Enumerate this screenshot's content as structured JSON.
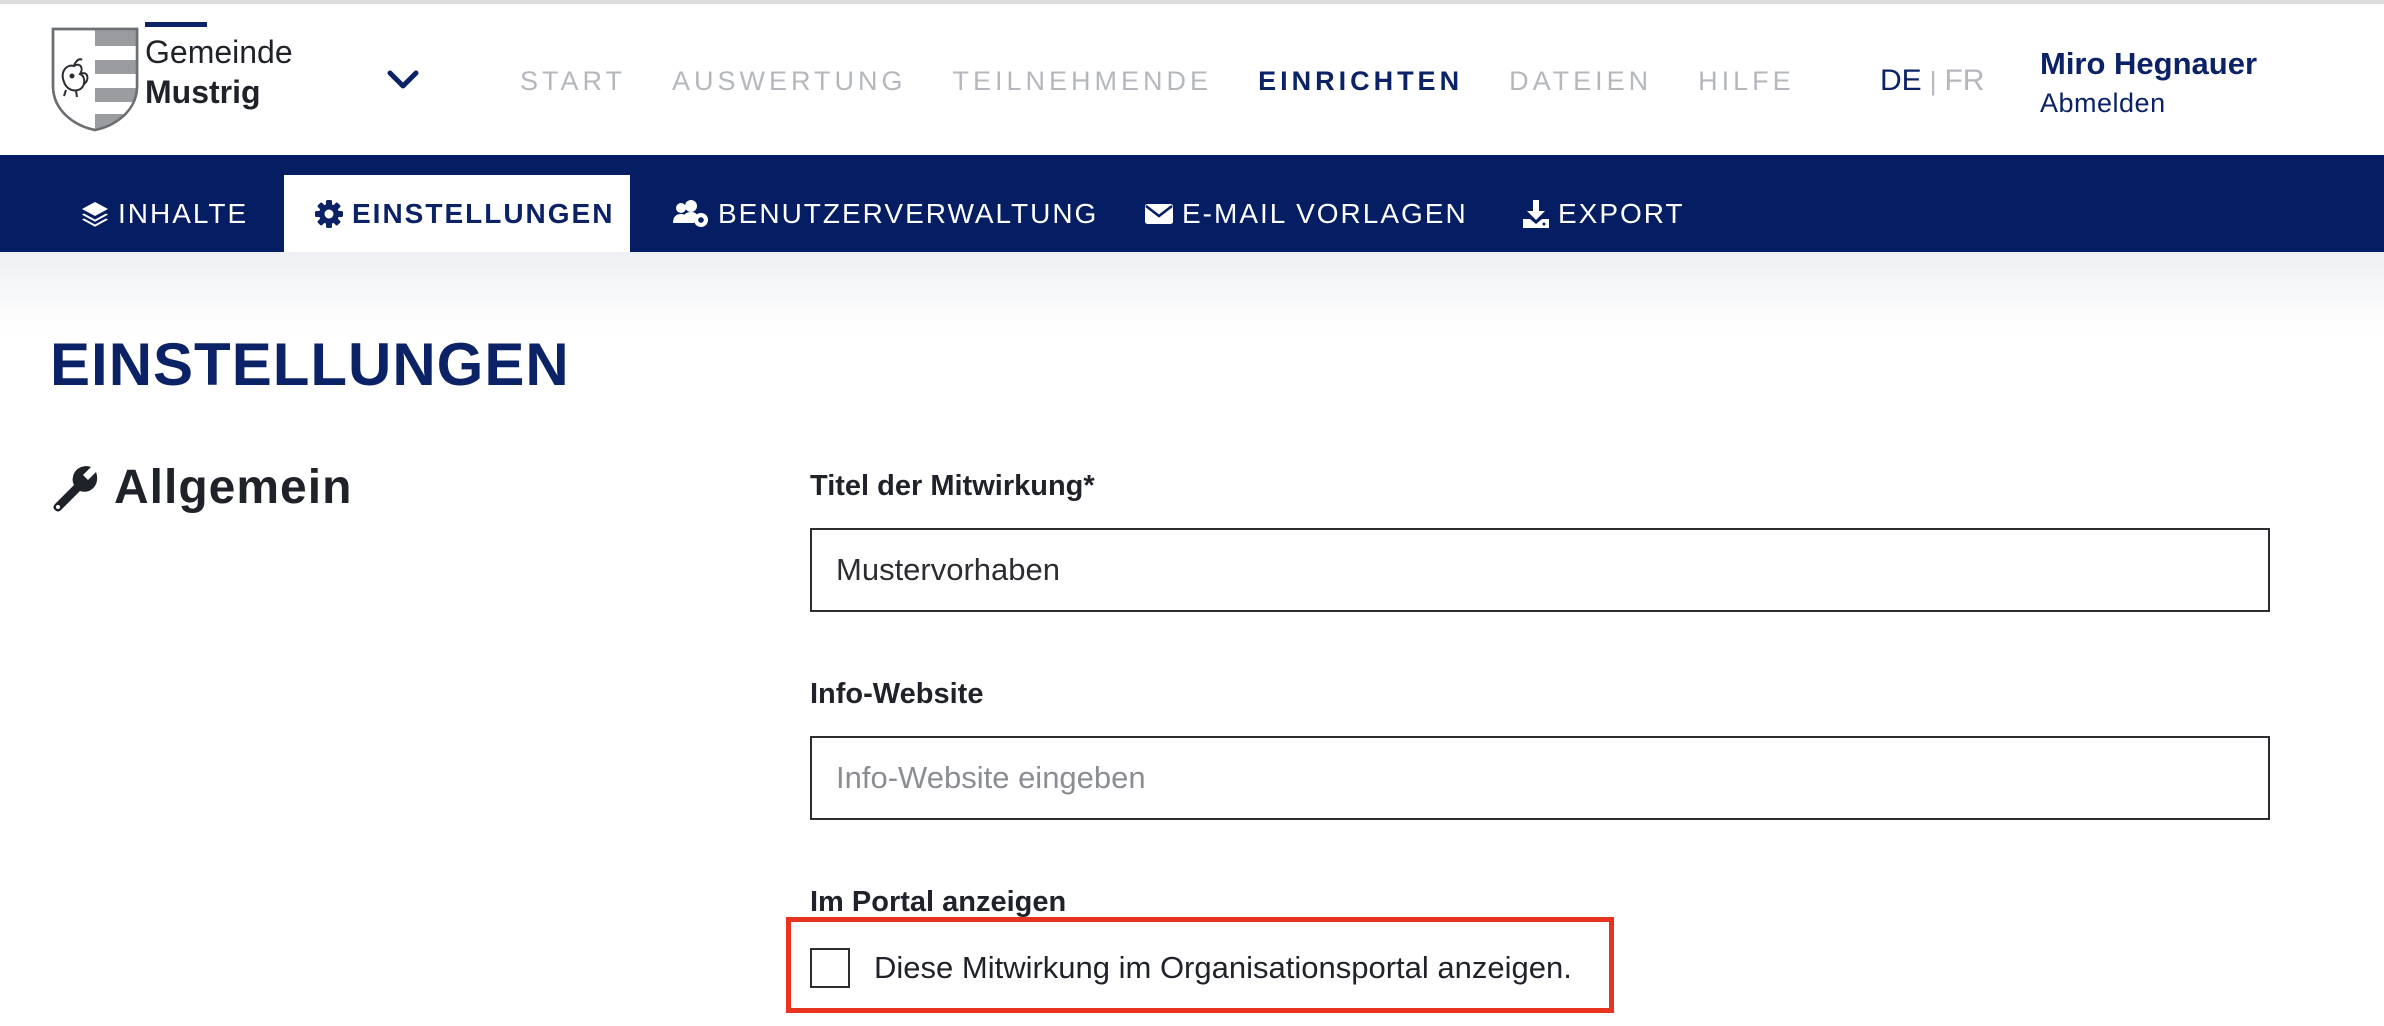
{
  "brand": {
    "line1": "Gemeinde",
    "line2": "Mustrig",
    "accent_color": "#0b2366",
    "dropdown_icon": "chevron-down-icon",
    "logo_icon": "coat-of-arms-squirrel"
  },
  "main_nav": {
    "items": [
      {
        "label": "START",
        "active": false
      },
      {
        "label": "AUSWERTUNG",
        "active": false
      },
      {
        "label": "TEILNEHMENDE",
        "active": false
      },
      {
        "label": "EINRICHTEN",
        "active": true
      },
      {
        "label": "DATEIEN",
        "active": false
      },
      {
        "label": "HILFE",
        "active": false
      }
    ]
  },
  "language": {
    "de": "DE",
    "separator": "|",
    "fr": "FR",
    "selected": "DE"
  },
  "user": {
    "name": "Miro Hegnauer",
    "logout": "Abmelden"
  },
  "sub_nav": {
    "background_color": "#041d63",
    "items": [
      {
        "label": "INHALTE",
        "icon": "layers-icon",
        "active": false
      },
      {
        "label": "EINSTELLUNGEN",
        "icon": "gear-icon",
        "active": true
      },
      {
        "label": "BENUTZERVERWALTUNG",
        "icon": "users-gear-icon",
        "active": false
      },
      {
        "label": "E-MAIL VORLAGEN",
        "icon": "envelope-icon",
        "active": false
      },
      {
        "label": "EXPORT",
        "icon": "download-icon",
        "active": false
      }
    ]
  },
  "page": {
    "title": "EINSTELLUNGEN",
    "section": {
      "icon": "wrench-icon",
      "title": "Allgemein"
    }
  },
  "form": {
    "title_field": {
      "label": "Titel der Mitwirkung*",
      "value": "Mustervorhaben",
      "placeholder": ""
    },
    "website_field": {
      "label": "Info-Website",
      "value": "",
      "placeholder": "Info-Website eingeben"
    },
    "portal": {
      "label": "Im Portal anzeigen",
      "checkbox_label": "Diese Mitwirkung im Organisationsportal anzeigen.",
      "checked": false,
      "highlight_color": "#e8331f"
    }
  }
}
